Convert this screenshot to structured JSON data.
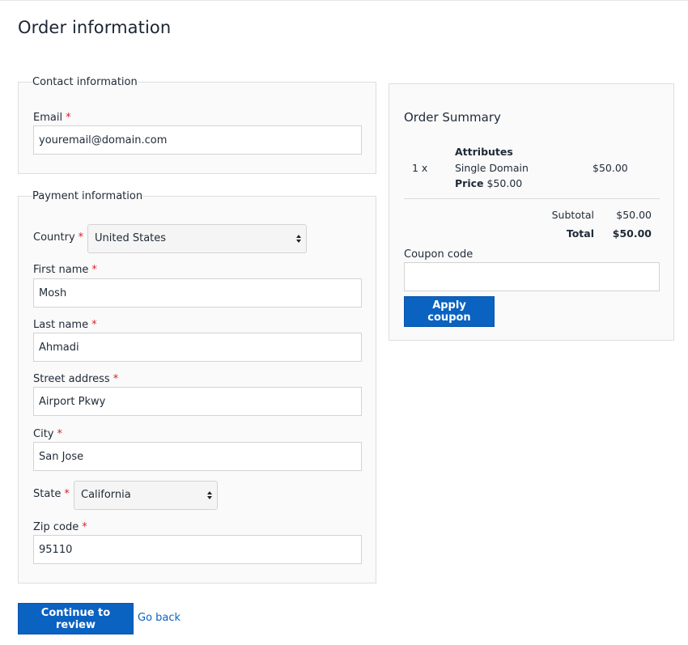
{
  "page": {
    "title": "Order information"
  },
  "contact": {
    "legend": "Contact information",
    "email_label": "Email",
    "email_value": "youremail@domain.com"
  },
  "payment": {
    "legend": "Payment information",
    "country_label": "Country",
    "country_value": "United States",
    "first_name_label": "First name",
    "first_name_value": "Mosh",
    "last_name_label": "Last name",
    "last_name_value": "Ahmadi",
    "street_label": "Street address",
    "street_value": "Airport Pkwy",
    "city_label": "City",
    "city_value": "San Jose",
    "state_label": "State",
    "state_value": "California",
    "zip_label": "Zip code",
    "zip_value": "95110"
  },
  "required_marker": "*",
  "summary": {
    "title": "Order Summary",
    "item": {
      "qty": "1 x",
      "attributes_label": "Attributes",
      "name": "Single Domain",
      "price_label": "Price",
      "price_value": "$50.00",
      "line_total": "$50.00"
    },
    "subtotal_label": "Subtotal",
    "subtotal_value": "$50.00",
    "total_label": "Total",
    "total_value": "$50.00",
    "coupon_label": "Coupon code",
    "coupon_value": "",
    "apply_button": "Apply coupon"
  },
  "actions": {
    "continue_button": "Continue to review",
    "go_back_link": "Go back"
  },
  "colors": {
    "accent": "#0a62c1",
    "required": "#d9232d",
    "panel_bg": "#fafafa",
    "border": "#dedede"
  }
}
